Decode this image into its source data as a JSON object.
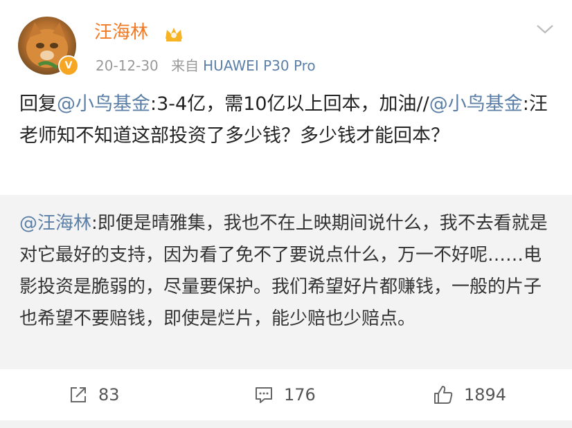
{
  "user": {
    "name": "汪海林",
    "date": "20-12-30",
    "source_label": "来自",
    "device": "HUAWEI P30 Pro",
    "verified_mark": "V"
  },
  "post": {
    "reply_label": "回复",
    "mention_1": "@小鸟基金",
    "text_1": ":3-4亿，需10亿以上回本，加油//",
    "mention_2": "@小鸟基金",
    "text_2": ":汪老师知不知道这部投资了多少钱？多少钱才能回本？"
  },
  "retweet": {
    "mention": "@汪海林",
    "text": ":即便是晴雅集，我也不在上映期间说什么，我不去看就是对它最好的支持，因为看了免不了要说点什么，万一不好呢……电影投资是脆弱的，尽量要保护。我们希望好片都赚钱，一般的片子也希望不要赔钱，即使是烂片，能少赔也少赔点。"
  },
  "actions": {
    "reposts": "83",
    "comments": "176",
    "likes": "1894"
  },
  "colors": {
    "username": "#f27a24",
    "link": "#5b7fa6",
    "meta": "#999999",
    "retweet_bg": "#f3f3f3"
  },
  "icons": [
    "avatar-image",
    "verified-badge-icon",
    "vip-crown-icon",
    "chevron-down-icon",
    "repost-icon",
    "comment-icon",
    "like-icon"
  ]
}
